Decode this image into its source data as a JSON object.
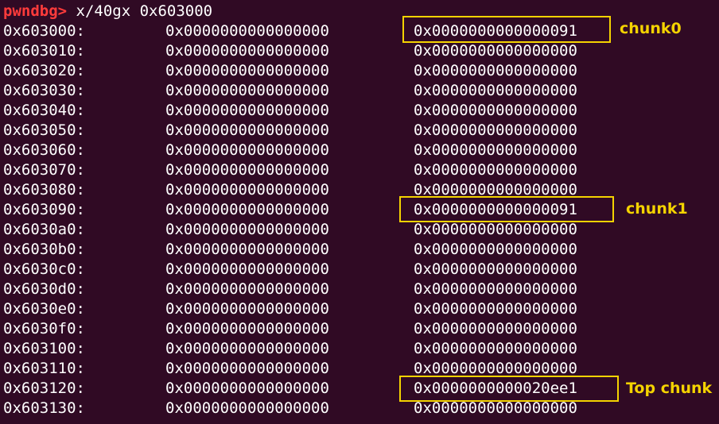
{
  "terminal": {
    "prompt": "pwndbg>",
    "command": "x/40gx 0x603000",
    "rows": [
      {
        "addr": "0x603000:",
        "v1": "0x0000000000000000",
        "v2": "0x0000000000000091"
      },
      {
        "addr": "0x603010:",
        "v1": "0x0000000000000000",
        "v2": "0x0000000000000000"
      },
      {
        "addr": "0x603020:",
        "v1": "0x0000000000000000",
        "v2": "0x0000000000000000"
      },
      {
        "addr": "0x603030:",
        "v1": "0x0000000000000000",
        "v2": "0x0000000000000000"
      },
      {
        "addr": "0x603040:",
        "v1": "0x0000000000000000",
        "v2": "0x0000000000000000"
      },
      {
        "addr": "0x603050:",
        "v1": "0x0000000000000000",
        "v2": "0x0000000000000000"
      },
      {
        "addr": "0x603060:",
        "v1": "0x0000000000000000",
        "v2": "0x0000000000000000"
      },
      {
        "addr": "0x603070:",
        "v1": "0x0000000000000000",
        "v2": "0x0000000000000000"
      },
      {
        "addr": "0x603080:",
        "v1": "0x0000000000000000",
        "v2": "0x0000000000000000"
      },
      {
        "addr": "0x603090:",
        "v1": "0x0000000000000000",
        "v2": "0x0000000000000091"
      },
      {
        "addr": "0x6030a0:",
        "v1": "0x0000000000000000",
        "v2": "0x0000000000000000"
      },
      {
        "addr": "0x6030b0:",
        "v1": "0x0000000000000000",
        "v2": "0x0000000000000000"
      },
      {
        "addr": "0x6030c0:",
        "v1": "0x0000000000000000",
        "v2": "0x0000000000000000"
      },
      {
        "addr": "0x6030d0:",
        "v1": "0x0000000000000000",
        "v2": "0x0000000000000000"
      },
      {
        "addr": "0x6030e0:",
        "v1": "0x0000000000000000",
        "v2": "0x0000000000000000"
      },
      {
        "addr": "0x6030f0:",
        "v1": "0x0000000000000000",
        "v2": "0x0000000000000000"
      },
      {
        "addr": "0x603100:",
        "v1": "0x0000000000000000",
        "v2": "0x0000000000000000"
      },
      {
        "addr": "0x603110:",
        "v1": "0x0000000000000000",
        "v2": "0x0000000000000000"
      },
      {
        "addr": "0x603120:",
        "v1": "0x0000000000000000",
        "v2": "0x0000000000020ee1"
      },
      {
        "addr": "0x603130:",
        "v1": "0x0000000000000000",
        "v2": "0x0000000000000000"
      }
    ]
  },
  "annotations": {
    "chunk0": "chunk0",
    "chunk1": "chunk1",
    "top_chunk": "Top chunk",
    "highlight_color": "#f4d300"
  },
  "colors": {
    "background": "#300a24",
    "prompt": "#ff3b3b",
    "text": "#ffffff"
  }
}
